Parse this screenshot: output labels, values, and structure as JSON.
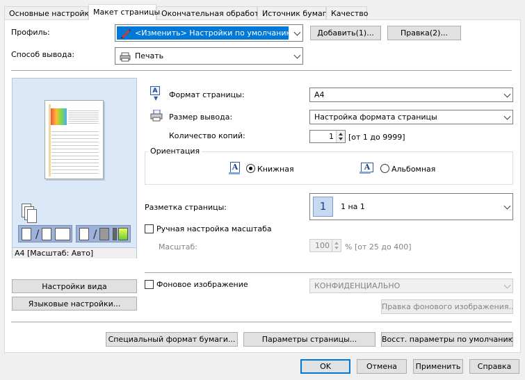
{
  "tabs": [
    {
      "label": "Основные настройки",
      "active": false
    },
    {
      "label": "Макет страницы",
      "active": true
    },
    {
      "label": "Окончательная обработка",
      "active": false
    },
    {
      "label": "Источник бумаги",
      "active": false
    },
    {
      "label": "Качество",
      "active": false
    }
  ],
  "profile": {
    "label": "Профиль:",
    "value": "<Изменить> Настройки по умолчанию",
    "add_button": "Добавить(1)...",
    "edit_button": "Правка(2)..."
  },
  "output_method": {
    "label": "Способ вывода:",
    "value": "Печать"
  },
  "preview": {
    "caption": "A4 [Масштаб: Авто]"
  },
  "page_format": {
    "label": "Формат страницы:",
    "value": "A4"
  },
  "output_size": {
    "label": "Размер вывода:",
    "value": "Настройка формата страницы"
  },
  "copies": {
    "label": "Количество копий:",
    "value": "1",
    "range": "[от 1 до 9999]"
  },
  "orientation": {
    "label": "Ориентация",
    "portrait": "Книжная",
    "landscape": "Альбомная",
    "selected": "portrait"
  },
  "page_layout": {
    "label": "Разметка страницы:",
    "value": "1 на 1",
    "badge": "1"
  },
  "manual_scale": {
    "label": "Ручная настройка масштаба",
    "scale_label": "Масштаб:",
    "value": "100",
    "range": "% [от 25 до 400]"
  },
  "watermark": {
    "label": "Фоновое изображение",
    "value": "КОНФИДЕНЦИАЛЬНО",
    "edit_button": "Правка фонового изображения..."
  },
  "left_buttons": {
    "view_settings": "Настройки вида",
    "language_settings": "Языковые настройки..."
  },
  "bottom_buttons": {
    "custom_paper": "Специальный формат бумаги...",
    "page_options": "Параметры страницы...",
    "restore_defaults": "Восст. параметры по умолчанию"
  },
  "dialog_buttons": {
    "ok": "OK",
    "cancel": "Отмена",
    "apply": "Применить",
    "help": "Справка"
  },
  "colors": {
    "accent": "#0078d7",
    "selection": "#0078d7",
    "preview_bg": "#dbe8f8"
  }
}
